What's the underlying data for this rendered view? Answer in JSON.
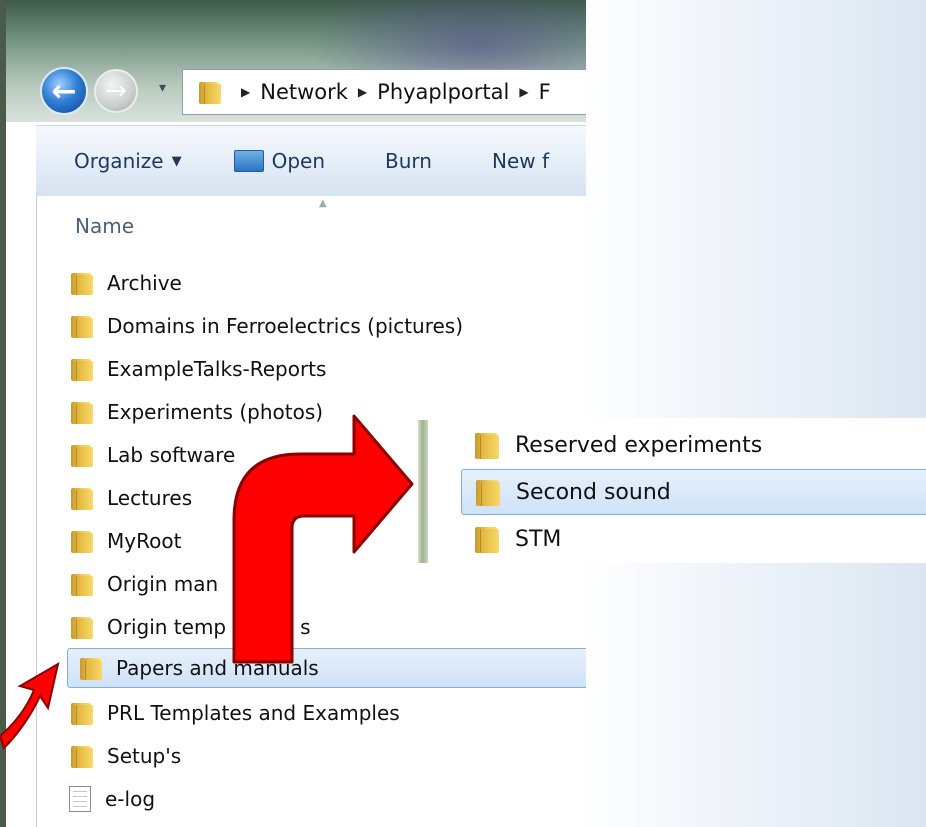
{
  "addressbar": {
    "breadcrumbs": [
      "Network",
      "Phyaplportal",
      "F"
    ]
  },
  "toolbar": {
    "organize": "Organize",
    "open": "Open",
    "burn": "Burn",
    "new_folder": "New f"
  },
  "list": {
    "column_header": "Name",
    "items": [
      {
        "name": "Archive",
        "type": "folder"
      },
      {
        "name": "Domains in Ferroelectrics (pictures)",
        "type": "folder"
      },
      {
        "name": "ExampleTalks-Reports",
        "type": "folder"
      },
      {
        "name": "Experiments (photos)",
        "type": "folder"
      },
      {
        "name": "Lab software",
        "type": "folder"
      },
      {
        "name": "Lectures",
        "type": "folder"
      },
      {
        "name": "MyRoot",
        "type": "folder"
      },
      {
        "name": "Origin man",
        "type": "folder"
      },
      {
        "name": "Origin temp",
        "type": "folder",
        "suffix": "s"
      },
      {
        "name": "Papers and manuals",
        "type": "folder",
        "selected": true
      },
      {
        "name": "PRL Templates and Examples",
        "type": "folder"
      },
      {
        "name": "Setup's",
        "type": "folder"
      },
      {
        "name": "e-log",
        "type": "file"
      }
    ]
  },
  "subfolder": {
    "items": [
      {
        "name": "Reserved experiments"
      },
      {
        "name": "Second sound",
        "selected": true
      },
      {
        "name": "STM"
      }
    ]
  },
  "colors": {
    "arrow": "#ff0000",
    "selection_border": "#84acdd",
    "selection_fill": "#cfe2f8",
    "toolbar_text": "#1e395b"
  }
}
